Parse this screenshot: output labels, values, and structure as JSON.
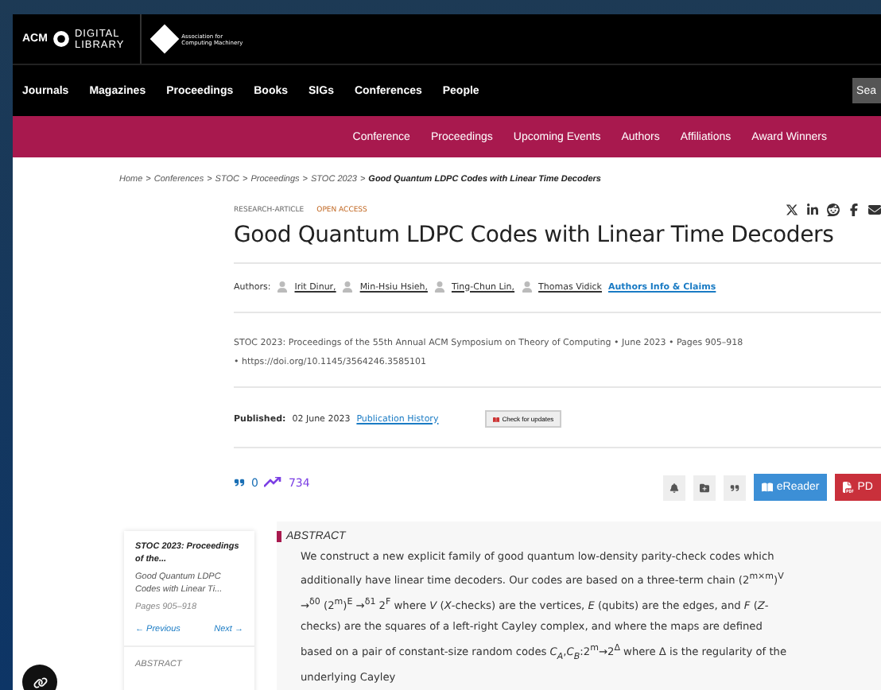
{
  "header": {
    "logo": {
      "acm": "ACM",
      "dl": [
        "DIGITAL",
        "LIBRARY"
      ]
    },
    "org": [
      "Association for",
      "Computing Machinery"
    ],
    "nav": [
      "Journals",
      "Magazines",
      "Proceedings",
      "Books",
      "SIGs",
      "Conferences",
      "People"
    ],
    "search_button": "Sea"
  },
  "subnav": [
    "Conference",
    "Proceedings",
    "Upcoming Events",
    "Authors",
    "Affiliations",
    "Award Winners"
  ],
  "breadcrumb": {
    "separator": ">",
    "items": [
      "Home",
      "Conferences",
      "STOC",
      "Proceedings",
      "STOC 2023"
    ],
    "current": "Good Quantum LDPC Codes with Linear Time Decoders"
  },
  "article": {
    "type": "RESEARCH-ARTICLE",
    "access": "OPEN ACCESS",
    "title": "Good Quantum LDPC Codes with Linear Time Decoders",
    "authors_label": "Authors:",
    "authors": [
      "Irit Dinur,",
      "Min-Hsiu Hsieh,",
      "Ting-Chun Lin,",
      "Thomas Vidick"
    ],
    "authors_link": "Authors Info & Claims",
    "bullet": "•",
    "venue": "STOC 2023: Proceedings of the 55th Annual ACM Symposium on Theory of Computing",
    "date": "June 2023",
    "pages": "Pages 905–918",
    "doi": "https://doi.org/10.1145/3564246.3585101",
    "published_label": "Published:",
    "published_date": "02 June 2023",
    "history_link": "Publication History",
    "updates_button": "Check for updates",
    "citations": "0",
    "downloads": "734",
    "ereader_button": "eReader",
    "pdf_button": "PD"
  },
  "sidebar": {
    "proceedings": "STOC 2023: Proceedings of the...",
    "article": "Good Quantum LDPC Codes with Linear Ti...",
    "pages": "Pages 905–918",
    "previous": "← Previous",
    "next": "Next →",
    "section": "ABSTRACT"
  },
  "abstract": {
    "heading": "ABSTRACT",
    "text": "We construct a new explicit family of good quantum low-density parity-check codes which additionally have linear time decoders. Our codes are based on a three-term chain (2$^{m×m}$)$^{V}$ →$^{δ0}$ (2$^{m}$)$^{E}$ →$^{δ1}$ 2$^{F}$ where *V* (*X*-checks) are the vertices, *E* (qubits) are the edges, and *F* (*Z*-checks) are the squares of a left-right Cayley complex, and where the maps are defined based on a pair of constant-size random codes *C$_{A}$*,*C$_{B}$*:2$^{m}$→2$^{Δ}$ where Δ is the regularity of the underlying Cayley"
  }
}
